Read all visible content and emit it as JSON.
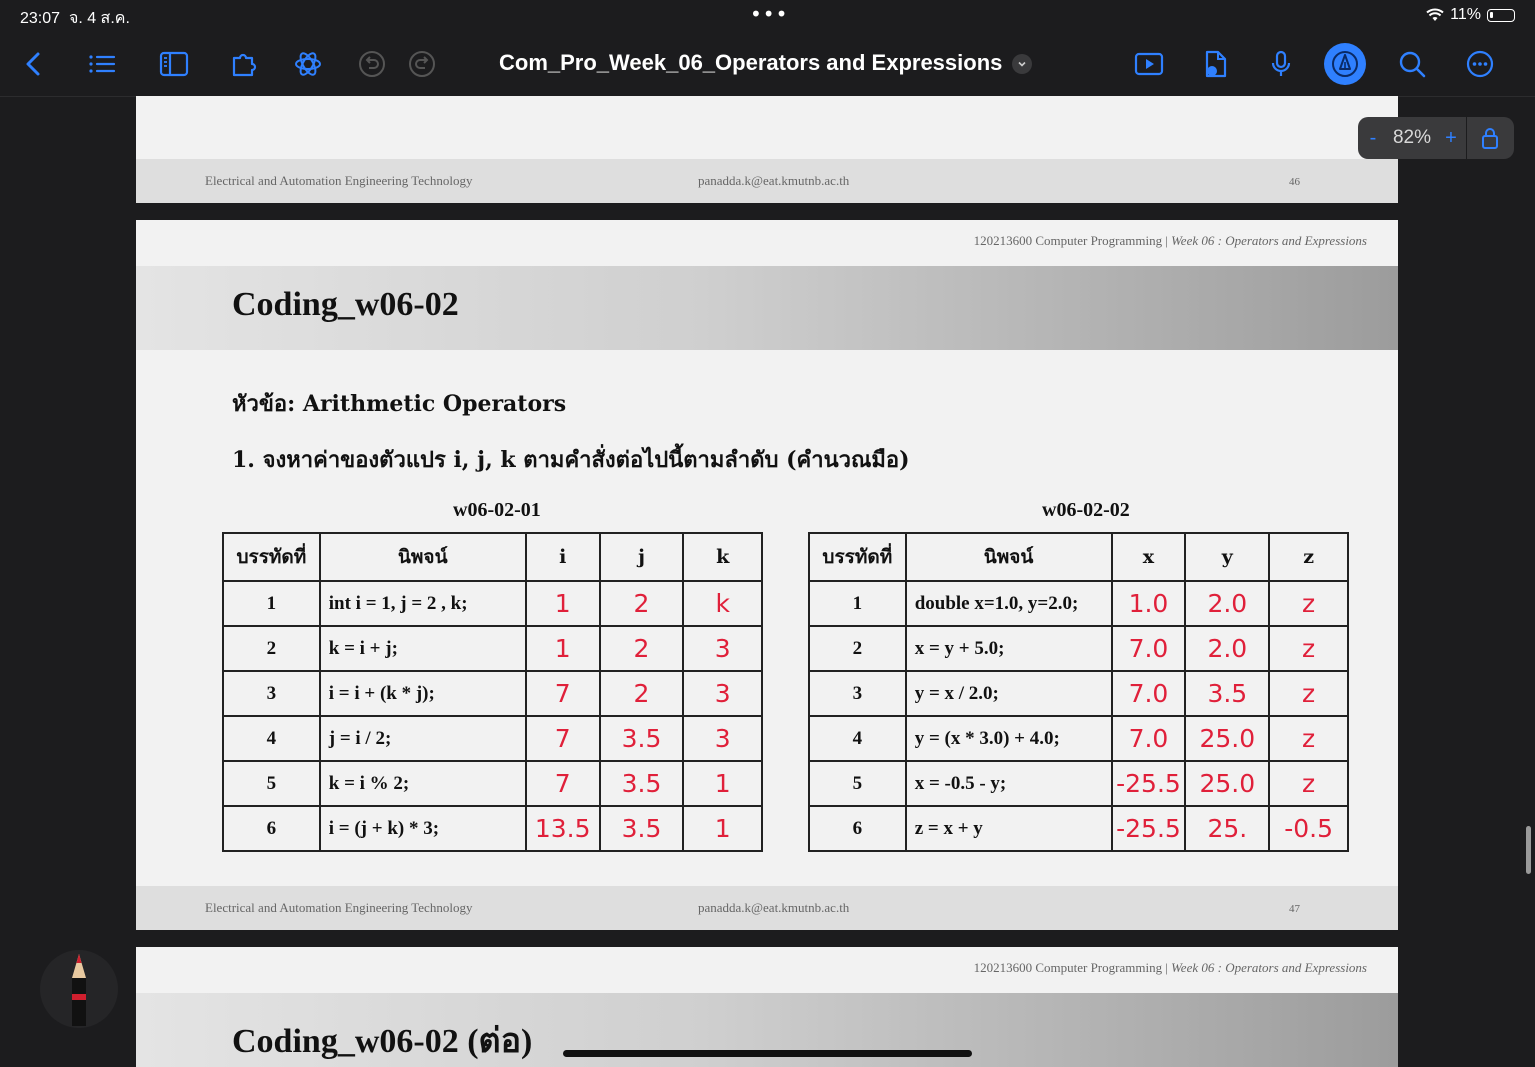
{
  "status": {
    "time": "23:07",
    "date": "จ. 4 ส.ค.",
    "battery": "11%"
  },
  "toolbar": {
    "title": "Com_Pro_Week_06_Operators and Expressions",
    "icons": [
      "back-icon",
      "list-icon",
      "sidebar-icon",
      "puzzle-icon",
      "ai-icon",
      "undo-icon",
      "redo-icon",
      "play-icon",
      "document-audio-icon",
      "microphone-icon",
      "pen-icon",
      "search-icon",
      "more-icon"
    ]
  },
  "zoom": {
    "minus": "-",
    "value": "82%",
    "plus": "+"
  },
  "footer": {
    "left": "Electrical and Automation Engineering Technology",
    "email": "panadda.k@eat.kmutnb.ac.th",
    "page_prev": "46",
    "page_cur": "47"
  },
  "header": {
    "course": "120213600 Computer Programming | ",
    "week": "Week 06 : Operators and Expressions"
  },
  "slide": {
    "title": "Coding_w06-02",
    "topic": "หัวข้อ: Arithmetic Operators",
    "question": "1. จงหาค่าของตัวแปร i, j, k ตามคำสั่งต่อไปนี้ตามลำดับ (คำนวณมือ)",
    "next_title": "Coding_w06-02 (ต่อ)"
  },
  "table1": {
    "caption": "w06-02-01",
    "headers": [
      "บรรทัดที่",
      "นิพจน์",
      "i",
      "j",
      "k"
    ],
    "rows": [
      [
        "1",
        "int i = 1, j = 2 , k;",
        "1",
        "2",
        "k"
      ],
      [
        "2",
        "k = i + j;",
        "1",
        "2",
        "3"
      ],
      [
        "3",
        "i = i + (k * j);",
        "7",
        "2",
        "3"
      ],
      [
        "4",
        "j = i / 2;",
        "7",
        "3.5",
        "3"
      ],
      [
        "5",
        "k = i % 2;",
        "7",
        "3.5",
        "1"
      ],
      [
        "6",
        "i = (j + k) * 3;",
        "13.5",
        "3.5",
        "1"
      ]
    ]
  },
  "table2": {
    "caption": "w06-02-02",
    "headers": [
      "บรรทัดที่",
      "นิพจน์",
      "x",
      "y",
      "z"
    ],
    "rows": [
      [
        "1",
        "double x=1.0, y=2.0;",
        "1.0",
        "2.0",
        "z"
      ],
      [
        "2",
        "x = y + 5.0;",
        "7.0",
        "2.0",
        "z"
      ],
      [
        "3",
        "y = x / 2.0;",
        "7.0",
        "3.5",
        "z"
      ],
      [
        "4",
        "y = (x * 3.0) + 4.0;",
        "7.0",
        "25.0",
        "z"
      ],
      [
        "5",
        "x = -0.5 - y;",
        "-25.5",
        "25.0",
        "z"
      ],
      [
        "6",
        "z = x + y",
        "-25.5",
        "25.",
        "-0.5"
      ]
    ]
  }
}
